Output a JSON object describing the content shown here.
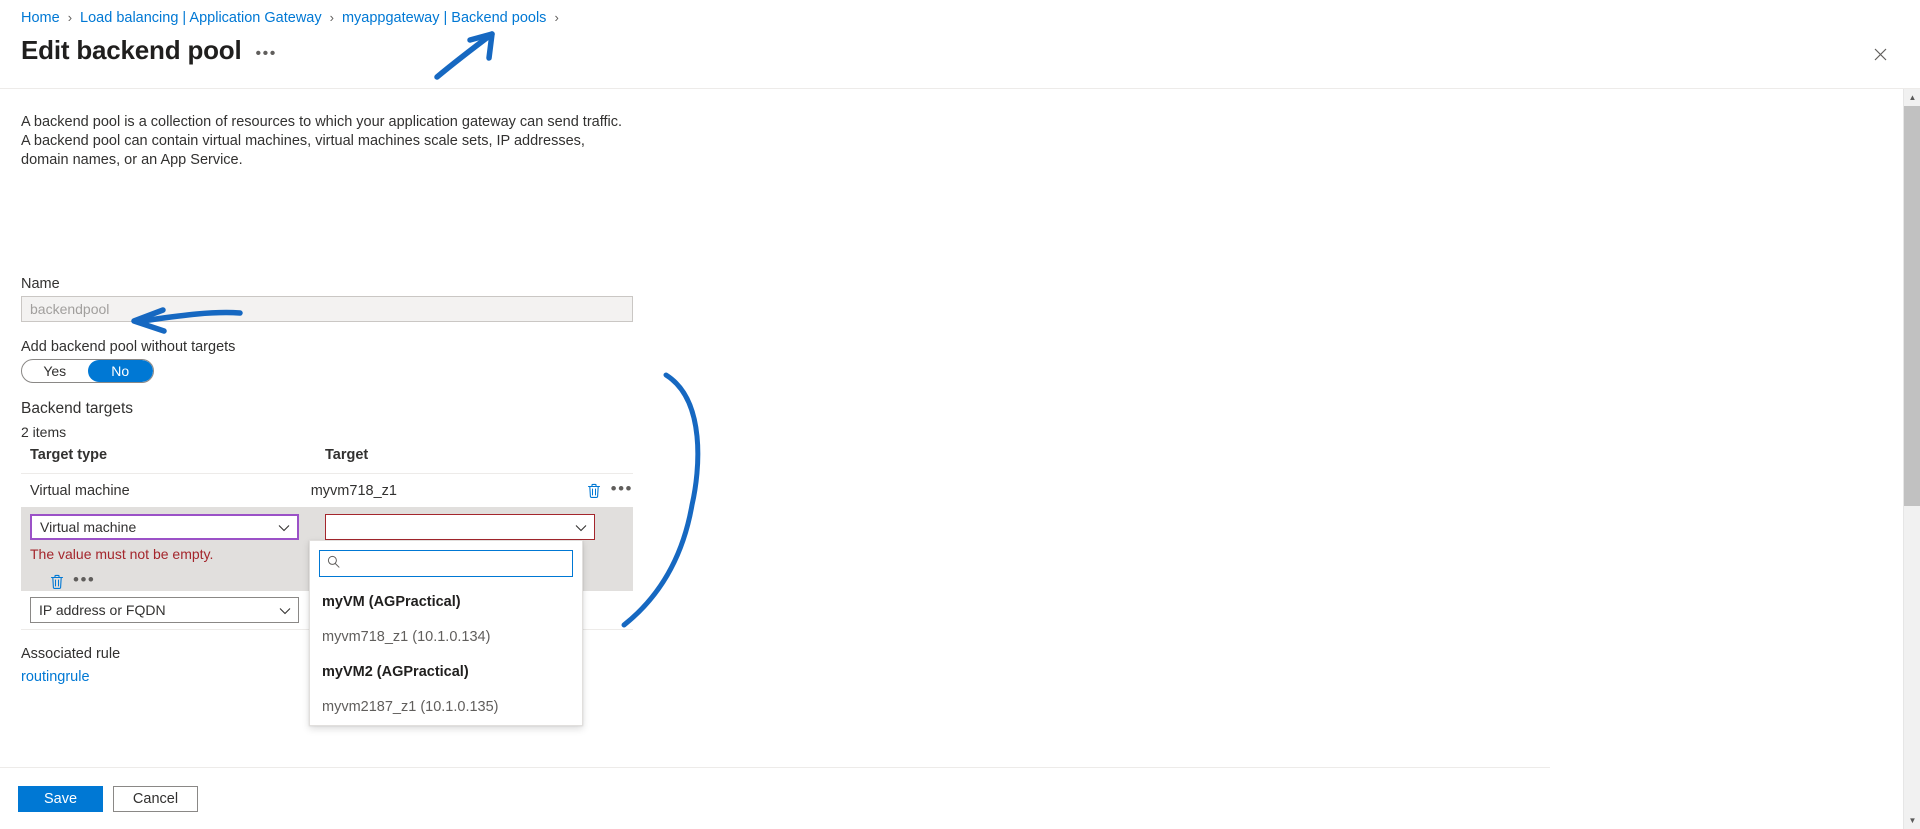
{
  "breadcrumb": {
    "items": [
      {
        "label": "Home"
      },
      {
        "label": "Load balancing | Application Gateway"
      },
      {
        "label": "myappgateway | Backend pools"
      }
    ],
    "separator": "›"
  },
  "header": {
    "title": "Edit backend pool",
    "overflow_ellipsis": "•••",
    "close_icon": "close-icon"
  },
  "main": {
    "description": "A backend pool is a collection of resources to which your application gateway can send traffic. A backend pool can contain virtual machines, virtual machines scale sets, IP addresses, domain names, or an App Service.",
    "name_label": "Name",
    "name_value": "backendpool",
    "name_placeholder": "backendpool",
    "toggle_label": "Add backend pool without targets",
    "toggle": {
      "options": [
        "Yes",
        "No"
      ],
      "selected": "No",
      "selected_color": "#0078d4"
    },
    "section_title": "Backend targets",
    "items_count": "2 items",
    "table": {
      "columns": [
        "Target type",
        "Target"
      ],
      "rows": [
        {
          "target_type": "Virtual machine",
          "target": "myvm718_z1",
          "editable": false,
          "delete_icon": "trash-icon",
          "more_icon": "more-actions-icon"
        },
        {
          "target_type": "Virtual machine",
          "target": "",
          "editable": true,
          "error": "The value must not be empty.",
          "error_color": "#a4262c",
          "delete_icon": "trash-icon",
          "more_icon": "more-actions-icon"
        }
      ],
      "new_row_type": "IP address or FQDN"
    },
    "dropdown": {
      "search_placeholder": "",
      "search_value": "",
      "search_icon": "search-icon",
      "items": [
        {
          "label": "myVM (AGPractical)",
          "kind": "group"
        },
        {
          "label": "myvm718_z1 (10.1.0.134)",
          "kind": "child"
        },
        {
          "label": "myVM2 (AGPractical)",
          "kind": "group"
        },
        {
          "label": "myvm2187_z1 (10.1.0.135)",
          "kind": "child"
        }
      ]
    },
    "associated_rule_label": "Associated rule",
    "associated_rule_value": "routingrule"
  },
  "footer": {
    "save_label": "Save",
    "cancel_label": "Cancel"
  },
  "scrollbar": {
    "up_arrow": "▲",
    "down_arrow": "▼"
  },
  "annotations": {
    "color": "#1668c1",
    "shapes": [
      "arrow-to-breadcrumb",
      "arrow-to-backend-targets",
      "bracket-around-dropdown"
    ]
  }
}
